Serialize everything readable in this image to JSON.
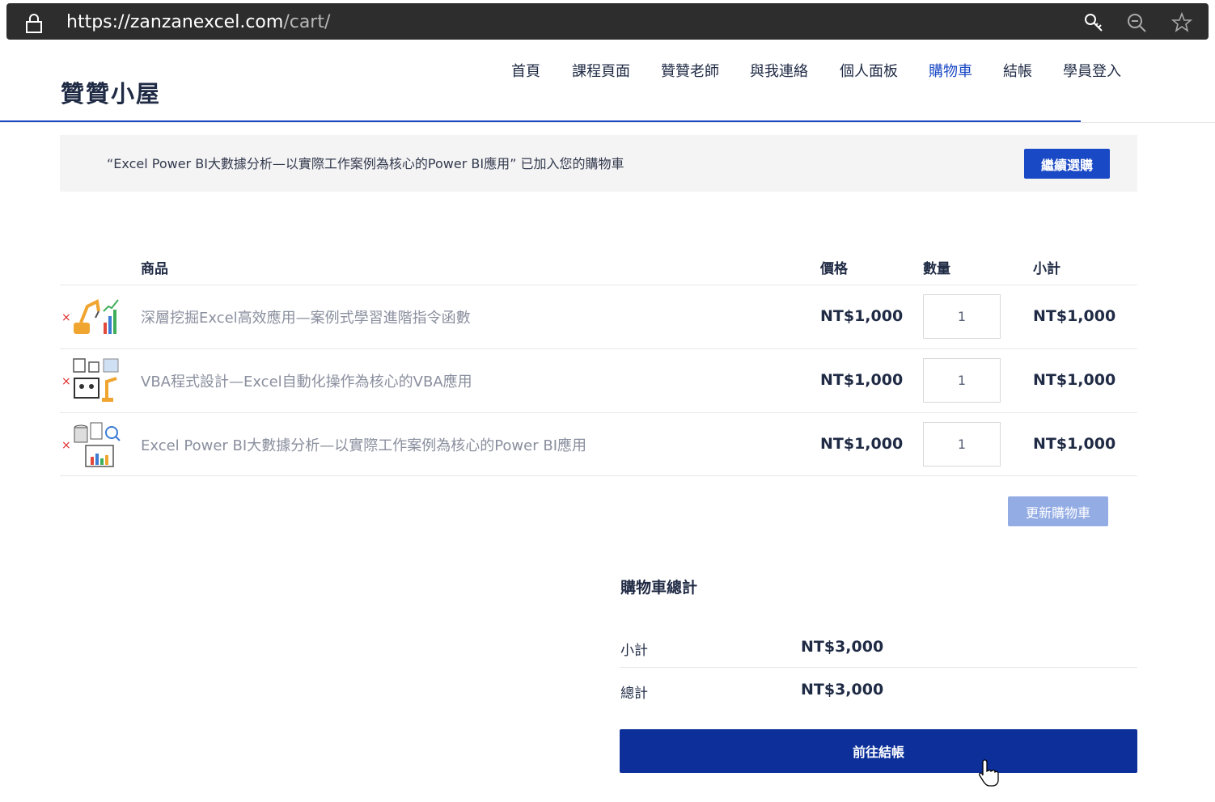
{
  "browser": {
    "url_host": "https://zanzanexcel.com",
    "url_path": "/cart/",
    "icons": [
      "lock-icon",
      "key-icon",
      "zoom-out-icon",
      "star-icon"
    ]
  },
  "site": {
    "logo": "贊贊小屋",
    "nav": [
      "首頁",
      "課程頁面",
      "贊贊老師",
      "與我連絡",
      "個人面板",
      "購物車",
      "結帳",
      "學員登入"
    ],
    "active_nav": "購物車",
    "accent_color": "#1a49c5"
  },
  "notice": {
    "text": "“Excel Power BI大數據分析—以實際工作案例為核心的Power BI應用” 已加入您的購物車",
    "button": "繼續選購"
  },
  "cart": {
    "headers": {
      "product": "商品",
      "price": "價格",
      "quantity": "數量",
      "subtotal": "小計"
    },
    "remove_symbol": "×",
    "items": [
      {
        "name": "深層挖掘Excel高效應用—案例式學習進階指令函數",
        "price": "NT$1,000",
        "quantity": "1",
        "subtotal": "NT$1,000"
      },
      {
        "name": "VBA程式設計—Excel自動化操作為核心的VBA應用",
        "price": "NT$1,000",
        "quantity": "1",
        "subtotal": "NT$1,000"
      },
      {
        "name": "Excel Power BI大數據分析—以實際工作案例為核心的Power BI應用",
        "price": "NT$1,000",
        "quantity": "1",
        "subtotal": "NT$1,000"
      }
    ],
    "update_button": "更新購物車"
  },
  "totals": {
    "title": "購物車總計",
    "subtotal_label": "小計",
    "subtotal_value": "NT$3,000",
    "total_label": "總計",
    "total_value": "NT$3,000",
    "checkout_button": "前往結帳"
  }
}
